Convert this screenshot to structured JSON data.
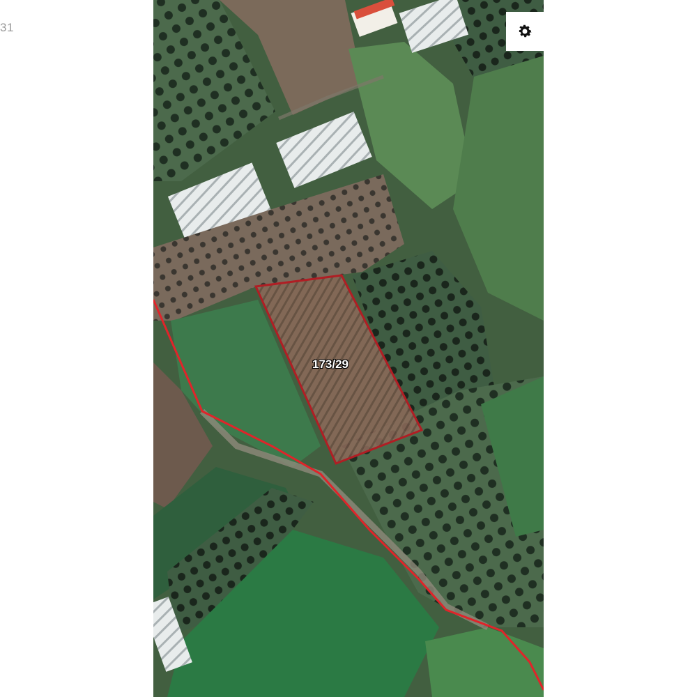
{
  "corner_text": "31",
  "map": {
    "parcel_label": "173/29",
    "boundary_color": "#e0242a",
    "parcel_color": "#b01e24",
    "settings_icon": "gear-icon"
  }
}
